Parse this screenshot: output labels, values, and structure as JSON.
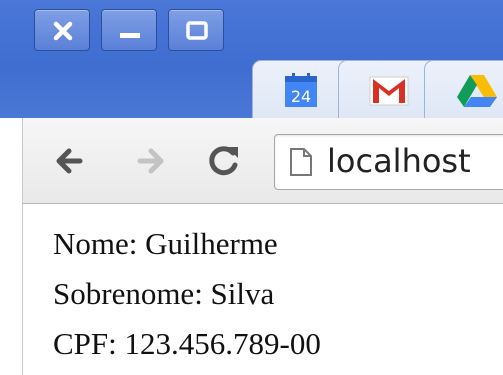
{
  "window": {
    "close_icon": "close-icon",
    "minimize_icon": "minimize-icon",
    "maximize_icon": "maximize-icon"
  },
  "tabs": [
    {
      "icon": "calendar-icon",
      "text": "24",
      "color": "#4285f4"
    },
    {
      "icon": "gmail-icon",
      "color": "#d93025"
    },
    {
      "icon": "google-drive-icon"
    }
  ],
  "toolbar": {
    "back_icon": "back-arrow-icon",
    "forward_icon": "forward-arrow-icon",
    "reload_icon": "reload-icon"
  },
  "address": {
    "page_icon": "page-icon",
    "url": "localhost"
  },
  "page": {
    "lines": [
      "Nome: Guilherme",
      "Sobrenome: Silva",
      "CPF: 123.456.789-00"
    ]
  }
}
